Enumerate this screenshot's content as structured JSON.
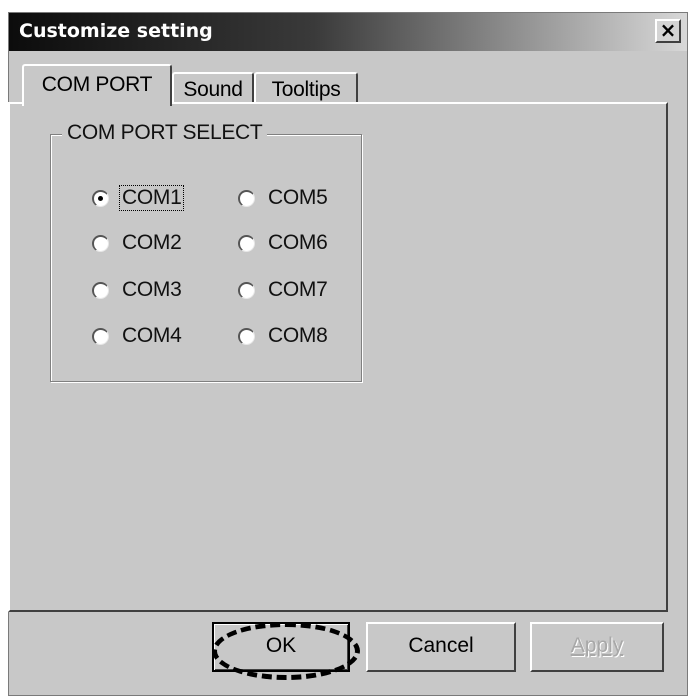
{
  "window": {
    "title": "Customize setting",
    "close_label": "×"
  },
  "tabs": [
    {
      "label": "COM PORT",
      "selected": true
    },
    {
      "label": "Sound",
      "selected": false
    },
    {
      "label": "Tooltips",
      "selected": false
    }
  ],
  "group": {
    "title": "COM PORT SELECT",
    "options": [
      {
        "label": "COM1",
        "checked": true,
        "focused": true
      },
      {
        "label": "COM2",
        "checked": false
      },
      {
        "label": "COM3",
        "checked": false
      },
      {
        "label": "COM4",
        "checked": false
      },
      {
        "label": "COM5",
        "checked": false
      },
      {
        "label": "COM6",
        "checked": false
      },
      {
        "label": "COM7",
        "checked": false
      },
      {
        "label": "COM8",
        "checked": false
      }
    ]
  },
  "buttons": {
    "ok": "OK",
    "cancel": "Cancel",
    "apply": "Apply",
    "apply_enabled": false,
    "ok_highlighted": true
  }
}
